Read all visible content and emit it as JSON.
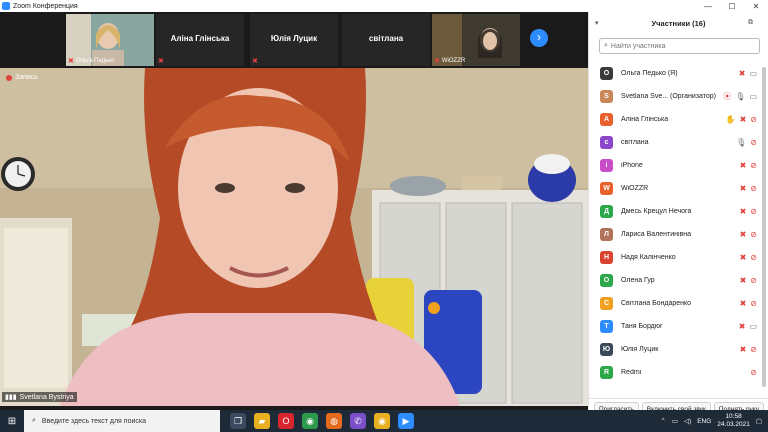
{
  "window": {
    "title": "Zoom Конференция",
    "minimize": "—",
    "maximize": "☐",
    "close": "✕"
  },
  "strip": {
    "tiles": [
      {
        "name": "Ольга Педько",
        "type": "video"
      },
      {
        "name": "Аліна Глінська",
        "type": "name"
      },
      {
        "name": "Юлія Луцик",
        "type": "name"
      },
      {
        "name": "світлана",
        "type": "name"
      },
      {
        "name": "WiOZZR",
        "type": "video"
      }
    ],
    "next_icon": "›"
  },
  "recording": {
    "label": "Запись"
  },
  "speaker": {
    "name": "Svetlana Bystriyа"
  },
  "panel": {
    "title": "Участники (16)",
    "search_placeholder": "Найти участника",
    "participants": [
      {
        "initial": "О",
        "name": "Ольга Педько (Я)",
        "color": "#3a3a3a",
        "mic": "off",
        "cam": "on"
      },
      {
        "initial": "S",
        "name": "Svetlana Sve... (Организатор)",
        "color": "#c9875a",
        "mic": "on",
        "cam": "on",
        "rec": true
      },
      {
        "initial": "А",
        "name": "Аліна Глінська",
        "color": "#e8612c",
        "mic": "off",
        "cam": "off",
        "hand": true
      },
      {
        "initial": "с",
        "name": "світлана",
        "color": "#8c46c9",
        "mic": "on",
        "cam": "off"
      },
      {
        "initial": "i",
        "name": "iPhone",
        "color": "#c94cc9",
        "mic": "off",
        "cam": "off"
      },
      {
        "initial": "W",
        "name": "WiOZZR",
        "color": "#e8612c",
        "mic": "off",
        "cam": "off"
      },
      {
        "initial": "Д",
        "name": "Дмесь Крецул Нечога",
        "color": "#2ca84b",
        "mic": "off",
        "cam": "off"
      },
      {
        "initial": "Л",
        "name": "Лариса Валентинівна",
        "color": "#b0735a",
        "mic": "off",
        "cam": "off"
      },
      {
        "initial": "Н",
        "name": "Надя Калінченко",
        "color": "#d9432f",
        "mic": "off",
        "cam": "off"
      },
      {
        "initial": "О",
        "name": "Олена Гур",
        "color": "#2ca84b",
        "mic": "off",
        "cam": "off"
      },
      {
        "initial": "С",
        "name": "Світлана Бондаренко",
        "color": "#f0a020",
        "mic": "off",
        "cam": "off"
      },
      {
        "initial": "Т",
        "name": "Таня Бордюг",
        "color": "#2d8cff",
        "mic": "off",
        "cam": "on"
      },
      {
        "initial": "Ю",
        "name": "Юлія Луцик",
        "color": "#3a4a5a",
        "mic": "off",
        "cam": "off"
      },
      {
        "initial": "R",
        "name": "Redmi",
        "color": "#2ca84b",
        "mic": "none",
        "cam": "off"
      }
    ],
    "footer": {
      "invite": "Пригласить",
      "unmute": "Включить свой звук",
      "raise_hand": "Поднять руку"
    }
  },
  "taskbar": {
    "search_placeholder": "Введите здесь текст для поиска",
    "lang": "ENG",
    "time": "10:58",
    "date": "24.03.2021"
  }
}
